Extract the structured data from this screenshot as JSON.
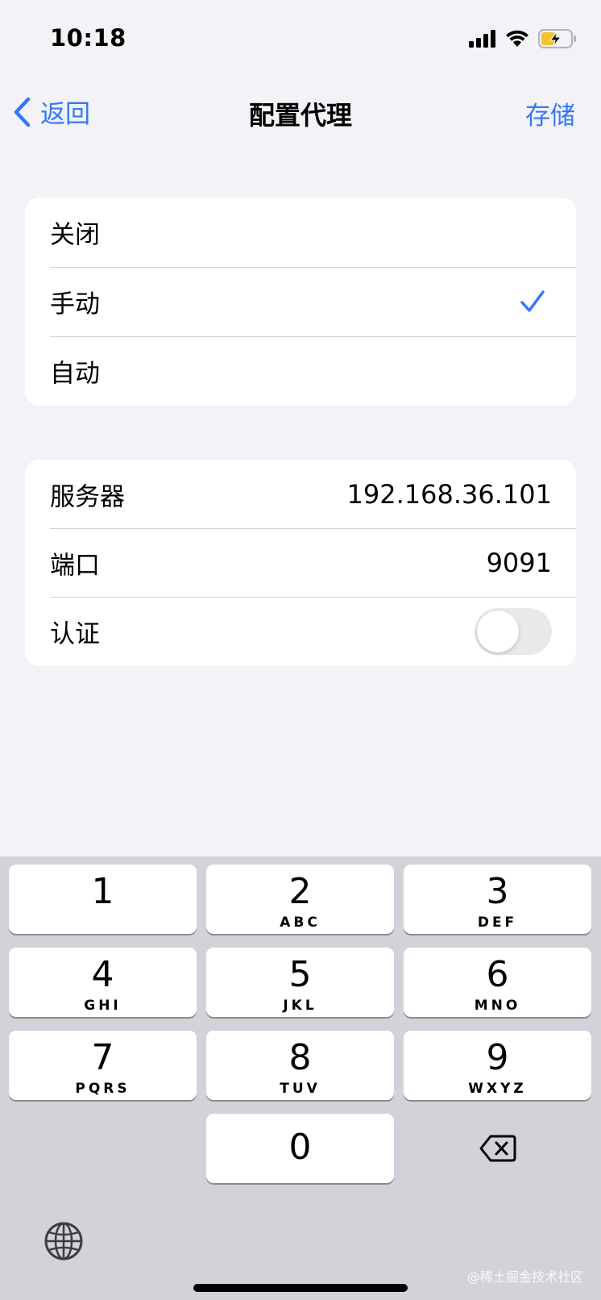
{
  "status_bar": {
    "time": "10:18",
    "icons": [
      "cellular-signal-icon",
      "wifi-icon",
      "battery-charging-icon"
    ]
  },
  "nav": {
    "back_label": "返回",
    "title": "配置代理",
    "save_label": "存储"
  },
  "proxy_modes": [
    {
      "label": "关闭",
      "selected": false
    },
    {
      "label": "手动",
      "selected": true
    },
    {
      "label": "自动",
      "selected": false
    }
  ],
  "settings": {
    "server_label": "服务器",
    "server_value": "192.168.36.101",
    "port_label": "端口",
    "port_value": "9091",
    "auth_label": "认证",
    "auth_enabled": false
  },
  "keyboard": {
    "keys": [
      {
        "num": "1",
        "letters": ""
      },
      {
        "num": "2",
        "letters": "ABC"
      },
      {
        "num": "3",
        "letters": "DEF"
      },
      {
        "num": "4",
        "letters": "GHI"
      },
      {
        "num": "5",
        "letters": "JKL"
      },
      {
        "num": "6",
        "letters": "MNO"
      },
      {
        "num": "7",
        "letters": "PQRS"
      },
      {
        "num": "8",
        "letters": "TUV"
      },
      {
        "num": "9",
        "letters": "WXYZ"
      },
      {
        "num": "0",
        "letters": ""
      }
    ]
  },
  "watermark": "@稀土掘金技术社区",
  "colors": {
    "accent": "#3478F6",
    "background": "#F2F2F7",
    "keyboard_bg": "#D1D3D9"
  }
}
